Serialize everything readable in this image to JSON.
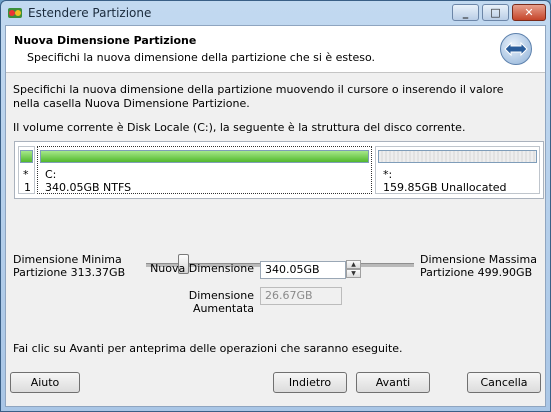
{
  "window": {
    "title": "Estendere Partizione",
    "controls": {
      "minimize": "_",
      "maximize": "□",
      "close": "✕"
    }
  },
  "header": {
    "title": "Nuova Dimensione Partizione",
    "subtitle": "Specifichi la nuova dimensione della partizione che si è esteso."
  },
  "instructions": "Specifichi la nuova dimensione della partizione muovendo il cursore o inserendo il valore nella casella Nuova Dimensione Partizione.",
  "current_volume": "Il volume corrente è Disk Locale (C:), la seguente è la struttura del disco corrente.",
  "disk": {
    "partitions": [
      {
        "name": "*",
        "info": "1"
      },
      {
        "name": "C:",
        "info": "340.05GB NTFS"
      },
      {
        "name": "*:",
        "info": "159.85GB Unallocated"
      }
    ]
  },
  "slider": {
    "min_label": "Dimensione Minima",
    "min_value": "Partizione 313.37GB",
    "max_label": "Dimensione Massima",
    "max_value": "Partizione 499.90GB",
    "position_fraction": 0.14
  },
  "fields": {
    "new_size_label": "Nuova Dimensione",
    "new_size_value": "340.05GB",
    "increased_label": "Dimensione Aumentata",
    "increased_value": "26.67GB"
  },
  "footer_text": "Fai clic su Avanti per anteprima delle operazioni che saranno eseguite.",
  "buttons": {
    "help": "Aiuto",
    "back": "Indietro",
    "next": "Avanti",
    "cancel": "Cancella"
  },
  "colors": {
    "used": "#52b82d",
    "unallocated": "#e2e2e2"
  },
  "icons": [
    "app-icon",
    "resize-arrows-icon",
    "spin-up-icon",
    "spin-down-icon"
  ]
}
